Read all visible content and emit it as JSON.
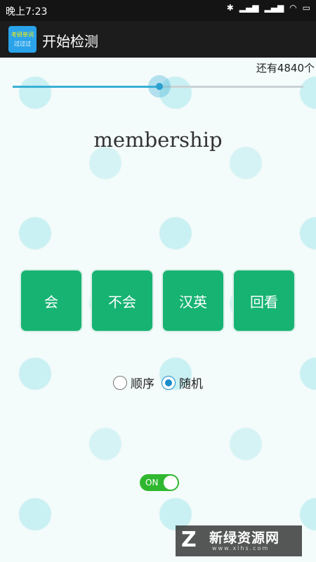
{
  "status_bar": {
    "time": "晚上7:23",
    "icons": [
      "bluetooth-icon",
      "signal-icon",
      "signal-icon",
      "wifi-icon",
      "battery-icon"
    ]
  },
  "app_bar": {
    "icon_line1": "考研单词",
    "icon_line2": "过过过",
    "title": "开始检测"
  },
  "progress": {
    "remaining_text": "还有4840个",
    "slider_fraction": 0.505
  },
  "word": "membership",
  "buttons": [
    {
      "label": "会"
    },
    {
      "label": "不会"
    },
    {
      "label": "汉英"
    },
    {
      "label": "回看"
    }
  ],
  "order_mode": {
    "options": [
      {
        "label": "顺序",
        "checked": false
      },
      {
        "label": "随机",
        "checked": true
      }
    ]
  },
  "toggle": {
    "label": "ON",
    "state": true
  },
  "watermark": {
    "logo": "Z",
    "text": "新绿资源网",
    "url": "www.xlhs.com"
  },
  "colors": {
    "accent_green": "#17b373",
    "slider_blue": "#3ab0d6",
    "toggle_green": "#2fb82f"
  }
}
